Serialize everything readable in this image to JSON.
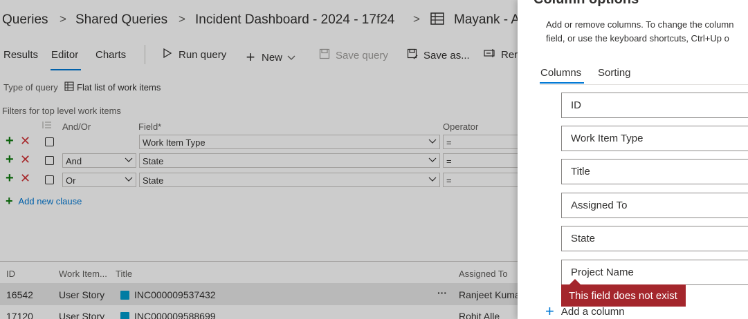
{
  "breadcrumb": {
    "items": [
      "Queries",
      "Shared Queries",
      "Incident Dashboard - 2024 - 17f24",
      "Mayank - A"
    ],
    "separator": ">"
  },
  "tabs": [
    {
      "label": "Results"
    },
    {
      "label": "Editor"
    },
    {
      "label": "Charts"
    }
  ],
  "toolbar": {
    "run_query": "Run query",
    "new": "New",
    "save_query": "Save query",
    "save_as": "Save as...",
    "rename": "Rer"
  },
  "query_type": {
    "label": "Type of query",
    "value": "Flat list of work items"
  },
  "filters": {
    "label": "Filters for top level work items",
    "headers": {
      "andor": "And/Or",
      "field": "Field*",
      "operator": "Operator"
    },
    "clauses": [
      {
        "andor": "",
        "field": "Work Item Type",
        "operator": "="
      },
      {
        "andor": "And",
        "field": "State",
        "operator": "="
      },
      {
        "andor": "Or",
        "field": "State",
        "operator": "="
      }
    ],
    "add_clause": "Add new clause"
  },
  "results": {
    "columns": [
      "ID",
      "Work Item...",
      "Title",
      "Assigned To"
    ],
    "rows": [
      {
        "id": "16542",
        "type": "User Story",
        "title": "INC000009537432",
        "assigned": "Ranjeet Kuma"
      },
      {
        "id": "17120",
        "type": "User Story",
        "title": "INC000009588699",
        "assigned": "Rohit Alle"
      }
    ],
    "more": "···"
  },
  "panel": {
    "title": "Column options",
    "description_line1": "Add or remove columns. To change the column",
    "description_line2": "field, or use the keyboard shortcuts, Ctrl+Up o",
    "tabs": [
      {
        "label": "Columns"
      },
      {
        "label": "Sorting"
      }
    ],
    "columns": [
      "ID",
      "Work Item Type",
      "Title",
      "Assigned To",
      "State",
      "Project Name"
    ],
    "error": "This field does not exist",
    "add_column": "Add a column"
  },
  "colors": {
    "accent": "#0078d4",
    "add_green": "#107c10",
    "delete_red": "#d13438",
    "error_bg": "#a4262c"
  }
}
